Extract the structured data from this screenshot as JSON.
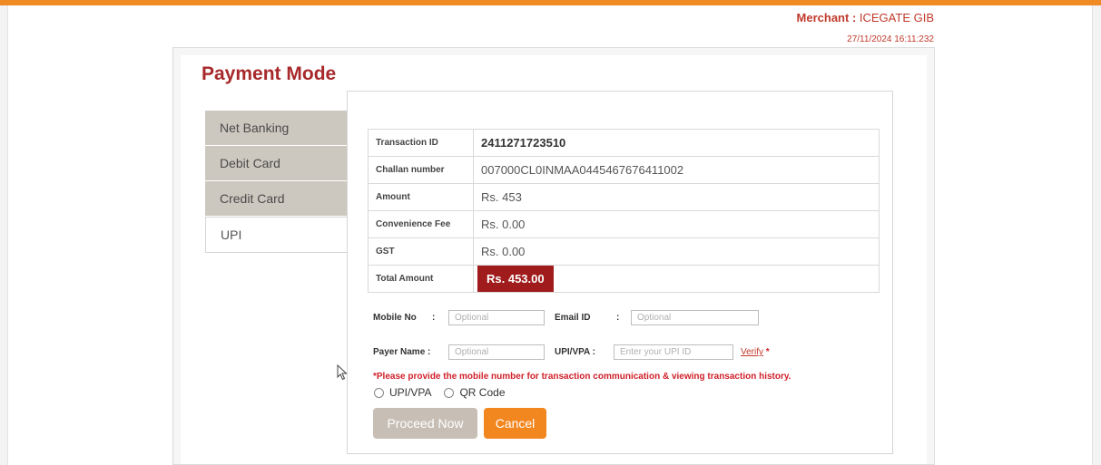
{
  "header": {
    "merchant_label": "Merchant",
    "merchant_name": "ICEGATE GIB",
    "datetime": "27/11/2024 16:11:232"
  },
  "page_title": "Payment Mode",
  "tabs": [
    {
      "label": "Net Banking"
    },
    {
      "label": "Debit Card"
    },
    {
      "label": "Credit Card"
    },
    {
      "label": "UPI"
    }
  ],
  "transaction": {
    "rows": [
      {
        "label": "Transaction ID",
        "value": "2411271723510"
      },
      {
        "label": "Challan number",
        "value": "007000CL0INMAA0445467676411002"
      },
      {
        "label": "Amount",
        "value": "Rs. 453"
      },
      {
        "label": "Convenience Fee",
        "value": "Rs. 0.00"
      },
      {
        "label": "GST",
        "value": "Rs. 0.00"
      },
      {
        "label": "Total Amount",
        "value": "Rs. 453.00"
      }
    ]
  },
  "form": {
    "mobile_label": "Mobile No",
    "mobile_placeholder": "Optional",
    "email_label": "Email ID",
    "email_placeholder": "Optional",
    "payer_label": "Payer Name :",
    "payer_placeholder": "Optional",
    "upi_label": "UPI/VPA :",
    "upi_placeholder": "Enter your UPI ID",
    "verify_label": "Verify",
    "required_mark": "*",
    "separator": ":"
  },
  "note": "*Please provide the mobile number for transaction communication & viewing transaction history.",
  "radio_options": [
    {
      "label": "UPI/VPA"
    },
    {
      "label": "QR Code"
    }
  ],
  "buttons": {
    "proceed": "Proceed Now",
    "cancel": "Cancel"
  },
  "colors": {
    "title": "#a8292b",
    "total_badge": "#a01c1c",
    "cancel_button": "#f2871f",
    "proceed_button_disabled": "#c7bfb6",
    "top_bar": "#f08a24"
  }
}
